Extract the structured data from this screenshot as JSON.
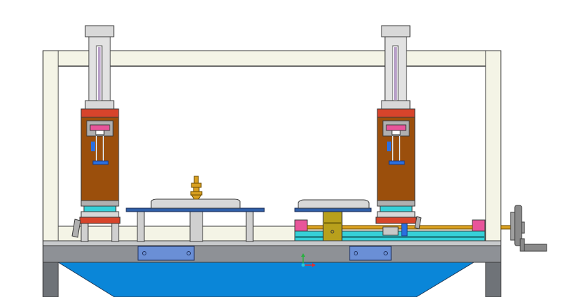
{
  "viewport": {
    "background": "#ffffff"
  },
  "colors": {
    "frame_fill": "#f4f4e6",
    "frame_stroke": "#3a3a3a",
    "base_gray": "#8e9196",
    "base_dark": "#6f7378",
    "hopper_blue": "#0a86d8",
    "press_brown": "#9b4f0c",
    "press_red": "#d7442b",
    "cyl_gray": "#d8d8d8",
    "rod_purple": "#b8a0c8",
    "plate_blue": "#2f5fa8",
    "slide_cyan": "#36d0d8",
    "pink": "#e8559a",
    "olive": "#b8a01c",
    "brass": "#d9a020",
    "wheel_gray": "#8a8a8a",
    "bracket_blue": "#6a8fd6",
    "axis_green": "#28b040",
    "axis_red": "#e03030",
    "axis_cyan": "#20c8e0"
  },
  "icons": {
    "left_press": "pneumatic-press-icon",
    "right_press": "pneumatic-press-icon",
    "handwheel": "handwheel-icon",
    "coordinate_triad": "axis-triad-icon"
  }
}
